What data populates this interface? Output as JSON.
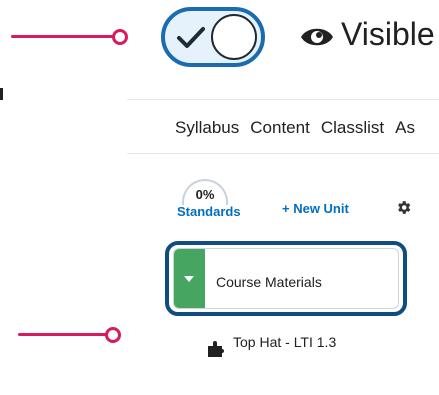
{
  "header": {
    "visibility_label": "Visible"
  },
  "tabs": [
    {
      "label": "Syllabus"
    },
    {
      "label": "Content"
    },
    {
      "label": "Classlist"
    },
    {
      "label": "As"
    }
  ],
  "toc": {
    "standards_percent": "0%",
    "standards_label": "Standards",
    "new_unit_label": "+ New Unit",
    "units": [
      {
        "title": "Course Materials"
      }
    ],
    "items": [
      {
        "title": "Top Hat - LTI 1.3"
      }
    ]
  },
  "colors": {
    "accent": "#006fbf",
    "toggle_border": "#1a6bb0",
    "unit_handle": "#46a661",
    "callout": "#d81b60"
  },
  "icons": [
    "check-icon",
    "eye-icon",
    "gear-icon",
    "caret-down-icon",
    "puzzle-piece-icon"
  ]
}
